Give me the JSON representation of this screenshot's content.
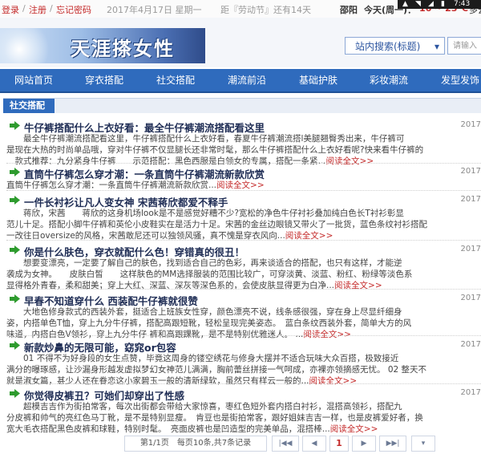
{
  "statusbar": {
    "login": "登录",
    "sep1": "/",
    "register": "注册",
    "sep2": "/",
    "forgot": "忘记密码",
    "date": "2017年4月17日 星期一",
    "countdown": "距『劳动节』还有14天",
    "city": "邵阳",
    "weather_day": "今天(周一)：",
    "temp": "16 ~ 23°C",
    "weather_desc": "多云",
    "sys_time": "7:43"
  },
  "header": {
    "logo_text": "天涯搽女性",
    "search_mode": "站内搜索(标题)",
    "search_placeholder": "请输入"
  },
  "nav": [
    "网站首页",
    "穿衣搭配",
    "社交搭配",
    "潮流前沿",
    "基础护肤",
    "彩妆潮流",
    "发型发饰"
  ],
  "section": {
    "title": "社交搭配"
  },
  "articles": [
    {
      "title": "牛仔裤搭配什么上衣好看：最全牛仔裤潮流搭配看这里",
      "date": "2017",
      "lines": [
        "　　最全牛仔裤潮流搭配看这里，牛仔裤搭配什么上衣好看，春夏牛仔裤潮流搭l美腿翘臀秀出来，牛仔裤可",
        "是现在大热的时尚单品哦，穿对牛仔裤不仅显腿长还非常时髦，那么牛仔裤搭配什么上衣好看呢?快来看牛仔裤的",
        "　款式推荐：九分紧身牛仔裤　　示范搭配：黑色西服是白领女的专属，搭配一条紧..."
      ],
      "more": "阅读全文>>"
    },
    {
      "title": "直筒牛仔裤怎么穿才潮：一条直筒牛仔裤潮流新款欣赏",
      "date": "2017",
      "lines": [
        "直筒牛仔裤怎么穿才潮：一条直筒牛仔裤潮流新款欣赏..."
      ],
      "more": "阅读全文>>"
    },
    {
      "title": "一件长衬衫让凡人变女神 宋茜蒋欣都爱不释手",
      "date": "2017",
      "lines": [
        "　　蒋欣，宋茜　　蒋欣的这身机场look是不是感觉好糟不少?宽松的净色牛仔衬衫叠加纯白色长T衬衫彰显",
        "范儿十足。搭配小脚牛仔裤和英伦小皮鞋实在是活力十足。宋茜的金丝边眼镜又带火了一批货，蓝色条纹衬衫搭配",
        "一改往日oversize的风格，宋茜敢尼还可以独领风骚，真不愧是穿衣风向..."
      ],
      "more": "阅读全文>>"
    },
    {
      "title": "你是什么肤色，穿衣就配什么色！穿错真的很丑！",
      "date": "2017",
      "lines": [
        "　　想要变漂亮，一定要了解自己的肤色，找到适合自己的色彩，再来谈适合的搭配，也只有这样，才能逆",
        "袭成为女神。　　皮肤白皙　　这样肤色的MM选择服装的范围比较广，可穿淡黄、淡蓝、粉红、粉绿等淡色系",
        "显得格外青春，柔和甜美；穿上大红、深蓝、深灰等深色系的，会使皮肤显得更为白净..."
      ],
      "more": "阅读全文>>"
    },
    {
      "title": "早春不知道穿什么 西装配牛仔裤就很赞",
      "date": "2017",
      "lines": [
        "　　大地色修身款式的西装外套，挺适合上班族女性穿，颜色漂亮不说，线条感很强，穿在身上尽显纤细身",
        "姿，内搭单色T恤，穿上九分牛仔裤，搭配高跟短靴，轻松呈现完美姿态。　蓝白条纹西装外套，简单大方的风",
        "味道，内搭白色V领衫，穿上九分牛仔 裤和高跟踝靴，是不是特别优雅迷人。 ..."
      ],
      "more": "阅读全文>>"
    },
    {
      "title": "新款炒鼻的无限可能，窈窕or包容",
      "date": "2017",
      "lines": [
        "　　01 不得不为好身段的女生点赞，毕竟这周身的镂空绣花与修身大摆并不适合玩味大众百搭，极致接近",
        "满分的曝琢感，让沙漏身形越发虚拟梦幻女神范儿满满，胸前蕾丝拼接一气呵成，亦裸亦领摘感无忧。 02 整天不",
        "就是淑女篇，甚少人还在眷恋这小家碧玉一般的清新绿软，虽然只有样云一般的..."
      ],
      "more": "阅读全文>>"
    },
    {
      "title": "你觉得皮裤丑？可她们却穿出了性感",
      "date": "2017",
      "lines": [
        "　　超模吉吉作为街拍常客，每次出街都会带给大家惊喜，枣红色短外套内搭白衬衫，混搭高领衫，搭配九",
        "分皮裤和帅气的亮红色马丁靴，是不是特别显瘦。　肯豆也是街拍常客，跟好姐妹吉吉一样，也是皮裤爱好者，换",
        "宽大毛衣搭配黑色皮裤和球鞋，特别时髦。　亮面皮裤也是凹造型的完美单品，混搭棒..."
      ],
      "more": "阅读全文>>"
    }
  ],
  "pager": {
    "info": "第1/1页　每页10条,共7条记录",
    "first": "|◀◀",
    "prev": "◀",
    "current": "1",
    "next": "▶",
    "last": "▶▶|"
  },
  "colors": {
    "nav_bg": "#2f6bbd",
    "link_red": "#c42a2a",
    "title_navy": "#1f2d55",
    "icon_green": "#2e9b2e"
  }
}
